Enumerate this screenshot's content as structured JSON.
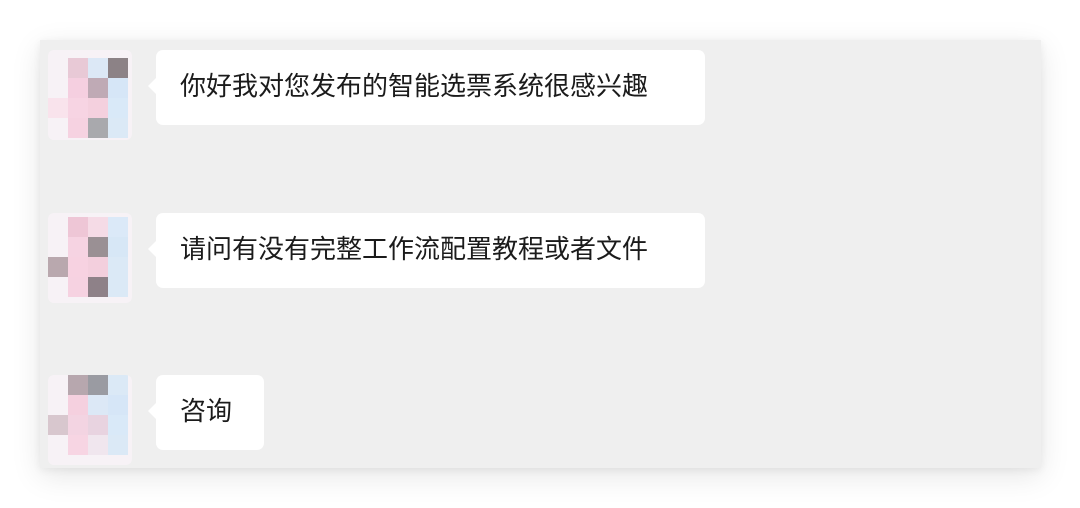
{
  "messages": [
    {
      "sender": "contact",
      "text": "你好我对您发布的智能选票系统很感兴趣"
    },
    {
      "sender": "contact",
      "text": "请问有没有完整工作流配置教程或者文件"
    },
    {
      "sender": "contact",
      "text": "咨询"
    }
  ],
  "colors": {
    "background": "#efefef",
    "bubble": "#ffffff",
    "text": "#1b1b1b"
  }
}
